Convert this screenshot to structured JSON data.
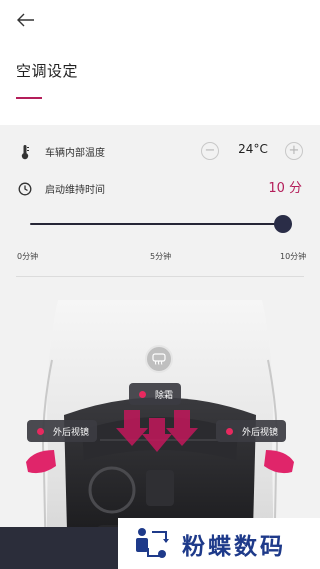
{
  "header": {
    "back_icon": "arrow-left-icon",
    "title": "空调设定"
  },
  "temperature": {
    "icon": "thermometer-icon",
    "label": "车辆内部温度",
    "value": "24°C",
    "decrease_label": "−",
    "increase_label": "+"
  },
  "duration": {
    "icon": "clock-icon",
    "label": "启动维持时间",
    "value": "10 分"
  },
  "slider": {
    "level_fraction": 1.0,
    "ticks": [
      "0分钟",
      "5分钟",
      "10分钟"
    ]
  },
  "car_controls": {
    "defrost_icon": "rear-defrost-icon",
    "defrost_label": "除霜",
    "left_mirror_label": "外后视镜",
    "right_mirror_label": "外后视镜",
    "indicator_color": "#e8295f"
  },
  "colors": {
    "accent": "#b41e5a",
    "slider": "#2a2d47",
    "dark_bar": "#2b2d3a"
  },
  "watermark": {
    "text": "粉蝶数码"
  }
}
